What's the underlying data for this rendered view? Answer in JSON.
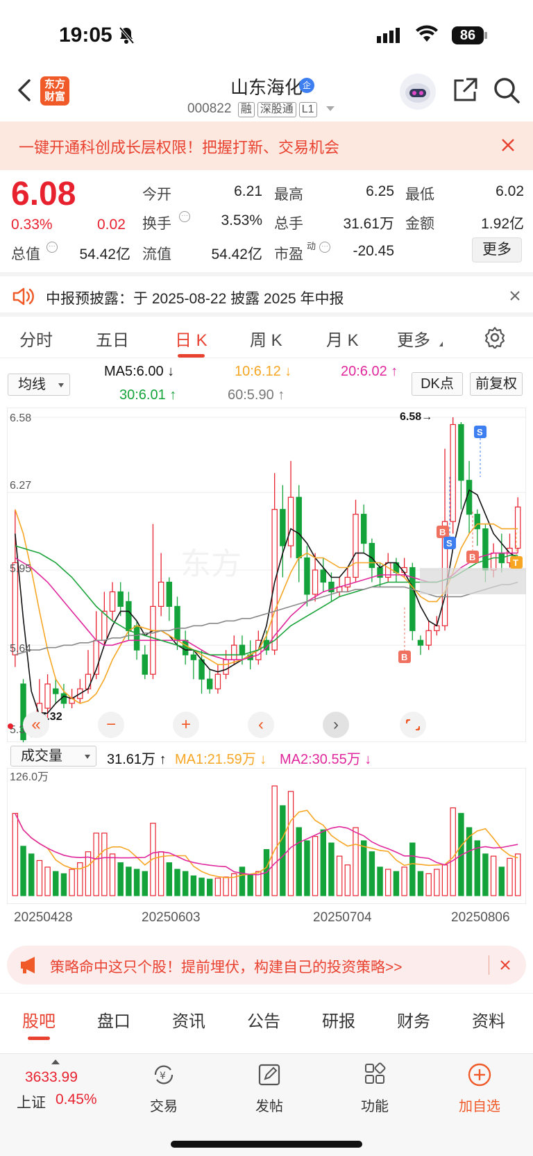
{
  "status_bar": {
    "time": "19:05",
    "battery": "86"
  },
  "header": {
    "logo_text": "东方财富",
    "stock_name": "山东海化",
    "stock_code": "000822",
    "tags": [
      "融",
      "深股通",
      "L1"
    ]
  },
  "promo_banner": {
    "text": "一键开通科创成长层权限！把握打新、交易机会"
  },
  "quote": {
    "price": "6.08",
    "change_pct": "0.33%",
    "change": "0.02",
    "rows": [
      [
        {
          "label": "今开",
          "value": "6.21"
        },
        {
          "label": "最高",
          "value": "6.25"
        },
        {
          "label": "最低",
          "value": "6.02"
        }
      ],
      [
        {
          "label": "换手",
          "value": "3.53%"
        },
        {
          "label": "总手",
          "value": "31.61万"
        },
        {
          "label": "金额",
          "value": "1.92亿"
        }
      ],
      [
        {
          "label": "总值",
          "value": "54.42亿"
        },
        {
          "label": "流值",
          "value": "54.42亿"
        },
        {
          "label": "市盈",
          "value": "-20.45"
        }
      ]
    ],
    "pe_superscript": "动",
    "more_label": "更多"
  },
  "notice": {
    "text": "中报预披露：于 2025-08-22 披露 2025 年中报"
  },
  "period_tabs": [
    "分时",
    "五日",
    "日 K",
    "周 K",
    "月 K",
    "更多"
  ],
  "active_period": "日 K",
  "ma_bar": {
    "selector": "均线",
    "ma5": "MA5:6.00 ↓",
    "ma10": "10:6.12 ↓",
    "ma20": "20:6.02 ↑",
    "ma30": "30:6.01 ↑",
    "ma60": "60:5.90 ↑",
    "dk_button": "DK点",
    "adjust_button": "前复权"
  },
  "chart_labels": {
    "price_ticks": [
      "6.58",
      "6.27",
      "5.95",
      "5.64",
      "5.32"
    ],
    "high_marker": "6.58→",
    "low_marker": "← 5.32",
    "signals": [
      "B",
      "S",
      "B",
      "S",
      "B",
      "T"
    ],
    "watermark": "东方"
  },
  "volume_bar": {
    "selector": "成交量",
    "volume": "31.61万 ↑",
    "ma1": "MA1:21.59万 ↓",
    "ma2": "MA2:30.55万 ↓",
    "max_label": "126.0万"
  },
  "dates": [
    "20250428",
    "20250603",
    "20250704",
    "20250806"
  ],
  "chart_data": {
    "type": "candlestick",
    "ylim": [
      5.32,
      6.58
    ],
    "volume_max": "126.0万",
    "candles": [
      [
        5.98,
        5.6,
        6.2,
        5.55,
        1
      ],
      [
        5.48,
        5.25,
        5.5,
        5.22,
        0
      ],
      [
        5.32,
        5.28,
        5.36,
        5.26,
        0
      ],
      [
        5.3,
        5.4,
        5.5,
        5.28,
        1
      ],
      [
        5.38,
        5.48,
        5.52,
        5.34,
        1
      ],
      [
        5.46,
        5.44,
        5.5,
        5.4,
        0
      ],
      [
        5.44,
        5.4,
        5.48,
        5.38,
        0
      ],
      [
        5.4,
        5.42,
        5.46,
        5.38,
        1
      ],
      [
        5.42,
        5.46,
        5.5,
        5.4,
        1
      ],
      [
        5.46,
        5.52,
        5.62,
        5.44,
        1
      ],
      [
        5.52,
        5.66,
        5.78,
        5.5,
        1
      ],
      [
        5.66,
        5.78,
        5.86,
        5.64,
        1
      ],
      [
        5.78,
        5.86,
        5.9,
        5.74,
        1
      ],
      [
        5.86,
        5.8,
        5.9,
        5.76,
        0
      ],
      [
        5.82,
        5.7,
        5.86,
        5.66,
        0
      ],
      [
        5.72,
        5.62,
        5.74,
        5.58,
        0
      ],
      [
        5.6,
        5.52,
        5.64,
        5.5,
        0
      ],
      [
        5.52,
        5.8,
        6.14,
        5.5,
        1
      ],
      [
        5.8,
        5.9,
        6.02,
        5.76,
        1
      ],
      [
        5.9,
        5.8,
        5.92,
        5.74,
        0
      ],
      [
        5.8,
        5.66,
        5.84,
        5.62,
        0
      ],
      [
        5.66,
        5.6,
        5.7,
        5.56,
        0
      ],
      [
        5.6,
        5.58,
        5.62,
        5.5,
        0
      ],
      [
        5.58,
        5.5,
        5.62,
        5.44,
        0
      ],
      [
        5.5,
        5.46,
        5.54,
        5.44,
        0
      ],
      [
        5.46,
        5.52,
        5.56,
        5.44,
        1
      ],
      [
        5.52,
        5.58,
        5.62,
        5.5,
        1
      ],
      [
        5.58,
        5.64,
        5.68,
        5.56,
        1
      ],
      [
        5.64,
        5.6,
        5.68,
        5.56,
        0
      ],
      [
        5.6,
        5.58,
        5.66,
        5.54,
        0
      ],
      [
        5.58,
        5.66,
        5.7,
        5.56,
        1
      ],
      [
        5.66,
        5.62,
        5.7,
        5.6,
        0
      ],
      [
        5.62,
        6.2,
        6.35,
        5.6,
        1
      ],
      [
        6.2,
        6.05,
        6.3,
        5.92,
        0
      ],
      [
        6.05,
        6.25,
        6.4,
        6.0,
        1
      ],
      [
        6.25,
        6.0,
        6.3,
        5.9,
        0
      ],
      [
        6.0,
        5.85,
        6.05,
        5.8,
        0
      ],
      [
        5.85,
        5.95,
        6.02,
        5.82,
        1
      ],
      [
        5.95,
        5.9,
        6.0,
        5.86,
        0
      ],
      [
        5.9,
        5.86,
        5.94,
        5.82,
        0
      ],
      [
        5.86,
        5.88,
        5.92,
        5.84,
        1
      ],
      [
        5.88,
        5.92,
        5.96,
        5.86,
        1
      ],
      [
        5.92,
        6.18,
        6.24,
        5.9,
        1
      ],
      [
        6.18,
        6.06,
        6.22,
        6.02,
        0
      ],
      [
        6.06,
        5.96,
        6.08,
        5.9,
        0
      ],
      [
        5.96,
        5.92,
        5.98,
        5.88,
        0
      ],
      [
        5.92,
        5.98,
        6.02,
        5.9,
        1
      ],
      [
        5.98,
        5.94,
        6.0,
        5.9,
        0
      ],
      [
        5.94,
        5.96,
        6.0,
        5.92,
        1
      ],
      [
        5.96,
        5.7,
        5.98,
        5.66,
        0
      ],
      [
        5.66,
        5.64,
        5.68,
        5.6,
        0
      ],
      [
        5.64,
        5.7,
        5.74,
        5.62,
        1
      ],
      [
        5.7,
        5.72,
        5.76,
        5.68,
        1
      ],
      [
        5.72,
        6.15,
        6.45,
        5.7,
        1
      ],
      [
        6.15,
        6.55,
        6.58,
        6.1,
        1
      ],
      [
        6.55,
        6.32,
        6.56,
        6.2,
        0
      ],
      [
        6.32,
        6.18,
        6.4,
        6.1,
        0
      ],
      [
        6.18,
        6.12,
        6.2,
        6.05,
        0
      ],
      [
        6.12,
        5.95,
        6.14,
        5.9,
        0
      ],
      [
        5.95,
        6.02,
        6.06,
        5.92,
        1
      ],
      [
        6.02,
        5.98,
        6.1,
        5.94,
        0
      ],
      [
        5.98,
        6.04,
        6.1,
        5.96,
        1
      ],
      [
        6.04,
        6.21,
        6.25,
        6.02,
        1
      ]
    ],
    "volumes": [
      0.75,
      0.45,
      0.38,
      0.32,
      0.26,
      0.22,
      0.2,
      0.24,
      0.3,
      0.4,
      0.57,
      0.57,
      0.38,
      0.3,
      0.26,
      0.24,
      0.22,
      0.66,
      0.4,
      0.3,
      0.24,
      0.22,
      0.18,
      0.16,
      0.15,
      0.16,
      0.17,
      0.2,
      0.26,
      0.19,
      0.22,
      0.42,
      1.0,
      0.82,
      0.95,
      0.62,
      0.5,
      0.54,
      0.6,
      0.48,
      0.36,
      0.28,
      0.62,
      0.5,
      0.4,
      0.26,
      0.24,
      0.22,
      0.26,
      0.48,
      0.22,
      0.2,
      0.24,
      0.28,
      0.8,
      0.75,
      0.62,
      0.5,
      0.38,
      0.36,
      0.26,
      0.34,
      0.38
    ],
    "ma_lines": {
      "MA5": [
        6.1,
        5.75,
        5.45,
        5.35,
        5.36,
        5.4,
        5.43,
        5.42,
        5.44,
        5.46,
        5.54,
        5.64,
        5.72,
        5.78,
        5.78,
        5.74,
        5.68,
        5.7,
        5.7,
        5.68,
        5.64,
        5.62,
        5.62,
        5.58,
        5.54,
        5.53,
        5.54,
        5.56,
        5.58,
        5.6,
        5.62,
        5.72,
        5.9,
        6.02,
        6.12,
        6.1,
        6.06,
        6.0,
        5.96,
        5.92,
        5.92,
        5.96,
        6.02,
        6.02,
        6.0,
        5.96,
        5.98,
        5.98,
        5.94,
        5.88,
        5.8,
        5.74,
        5.72,
        5.84,
        6.04,
        6.18,
        6.28,
        6.26,
        6.18,
        6.1,
        6.06,
        6.02,
        6.0
      ],
      "MA10": [
        6.2,
        6.1,
        5.95,
        5.78,
        5.62,
        5.5,
        5.45,
        5.42,
        5.4,
        5.41,
        5.44,
        5.5,
        5.58,
        5.64,
        5.7,
        5.72,
        5.71,
        5.7,
        5.7,
        5.68,
        5.66,
        5.64,
        5.62,
        5.6,
        5.58,
        5.56,
        5.56,
        5.57,
        5.58,
        5.6,
        5.62,
        5.68,
        5.78,
        5.86,
        5.94,
        6.0,
        6.02,
        6.0,
        6.0,
        5.98,
        5.96,
        5.96,
        5.98,
        5.98,
        5.98,
        5.98,
        5.96,
        5.94,
        5.92,
        5.88,
        5.84,
        5.82,
        5.82,
        5.86,
        5.94,
        6.04,
        6.1,
        6.14,
        6.14,
        6.14,
        6.12,
        6.12,
        6.12
      ],
      "MA20": [
        6.0,
        5.98,
        5.96,
        5.93,
        5.9,
        5.86,
        5.82,
        5.78,
        5.74,
        5.7,
        5.66,
        5.64,
        5.64,
        5.65,
        5.66,
        5.66,
        5.66,
        5.66,
        5.66,
        5.66,
        5.66,
        5.66,
        5.64,
        5.62,
        5.6,
        5.59,
        5.58,
        5.58,
        5.58,
        5.59,
        5.6,
        5.63,
        5.68,
        5.72,
        5.76,
        5.79,
        5.82,
        5.84,
        5.86,
        5.87,
        5.88,
        5.89,
        5.9,
        5.91,
        5.92,
        5.93,
        5.93,
        5.93,
        5.93,
        5.92,
        5.91,
        5.9,
        5.9,
        5.91,
        5.93,
        5.96,
        5.98,
        6.0,
        6.01,
        6.02,
        6.02,
        6.02,
        6.02
      ],
      "MA30": [
        6.05,
        6.04,
        6.03,
        6.02,
        6.0,
        5.98,
        5.95,
        5.92,
        5.88,
        5.84,
        5.8,
        5.77,
        5.74,
        5.72,
        5.7,
        5.69,
        5.68,
        5.67,
        5.66,
        5.65,
        5.64,
        5.63,
        5.62,
        5.61,
        5.6,
        5.6,
        5.6,
        5.6,
        5.6,
        5.61,
        5.62,
        5.64,
        5.66,
        5.69,
        5.72,
        5.74,
        5.76,
        5.78,
        5.8,
        5.82,
        5.84,
        5.85,
        5.86,
        5.87,
        5.88,
        5.89,
        5.9,
        5.9,
        5.9,
        5.9,
        5.9,
        5.9,
        5.9,
        5.91,
        5.92,
        5.94,
        5.96,
        5.98,
        5.99,
        6.0,
        6.0,
        6.01,
        6.01
      ],
      "MA60": [
        5.6,
        5.61,
        5.62,
        5.62,
        5.63,
        5.63,
        5.64,
        5.64,
        5.65,
        5.65,
        5.66,
        5.66,
        5.67,
        5.67,
        5.68,
        5.68,
        5.69,
        5.69,
        5.7,
        5.7,
        5.71,
        5.71,
        5.72,
        5.72,
        5.73,
        5.73,
        5.74,
        5.74,
        5.75,
        5.75,
        5.76,
        5.77,
        5.78,
        5.79,
        5.8,
        5.81,
        5.82,
        5.83,
        5.84,
        5.85,
        5.86,
        5.86,
        5.87,
        5.87,
        5.88,
        5.88,
        5.88,
        5.88,
        5.88,
        5.87,
        5.86,
        5.85,
        5.84,
        5.84,
        5.84,
        5.84,
        5.85,
        5.86,
        5.87,
        5.88,
        5.89,
        5.89,
        5.9
      ]
    }
  },
  "ad_banner": {
    "text": "策略命中这只个股！提前埋伏，构建自己的投资策略>>"
  },
  "bottom_tabs": [
    "股吧",
    "盘口",
    "资讯",
    "公告",
    "研报",
    "财务",
    "资料"
  ],
  "active_bottom_tab": "股吧",
  "tabbar": {
    "index_value": "3633.99",
    "index_name": "上证",
    "index_change": "0.45%",
    "items": [
      "交易",
      "发帖",
      "功能",
      "加自选"
    ]
  },
  "colors": {
    "rise": "#e8212f",
    "fall": "#13a33a",
    "accent": "#f05a28",
    "ma5": "#111111",
    "ma10": "#f6a623",
    "ma20": "#e0269c",
    "ma30": "#1aa33a",
    "ma60": "#888888"
  }
}
